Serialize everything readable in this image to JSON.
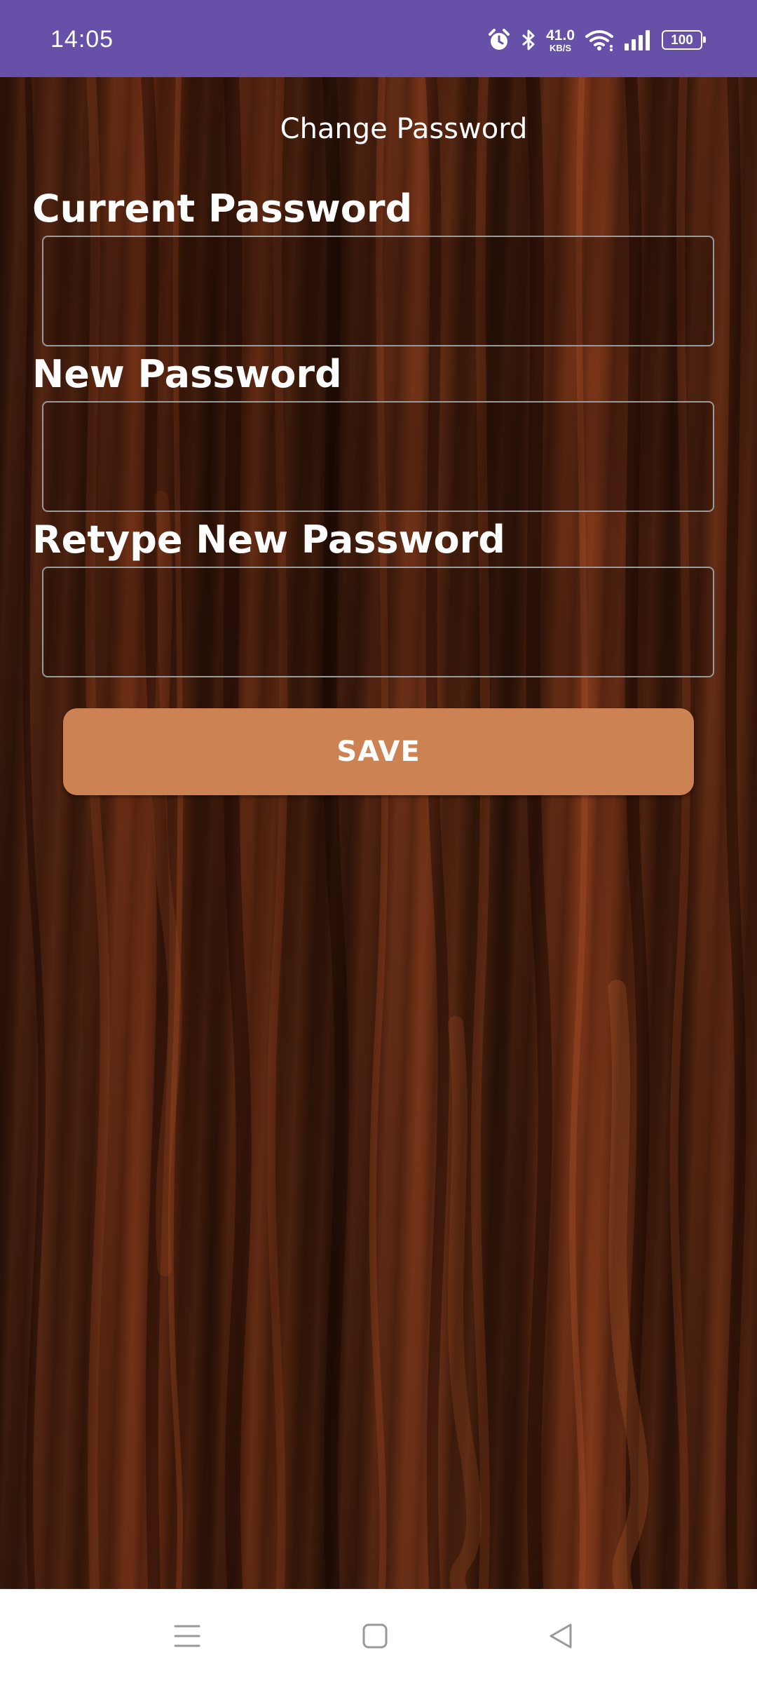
{
  "status_bar": {
    "time": "14:05",
    "network_speed_value": "41.0",
    "network_speed_unit": "KB/S",
    "battery_level": "100",
    "icons": [
      "alarm-icon",
      "bluetooth-icon",
      "wifi-icon",
      "signal-icon",
      "battery-icon"
    ]
  },
  "screen": {
    "title": "Change Password"
  },
  "form": {
    "current_password_label": "Current Password",
    "current_password_value": "",
    "new_password_label": "New Password",
    "new_password_value": "",
    "retype_password_label": "Retype New Password",
    "retype_password_value": "",
    "save_label": "SAVE"
  },
  "nav_bar": {
    "icons": [
      "menu-icon",
      "home-icon",
      "back-icon"
    ]
  },
  "colors": {
    "status_bar": "#6650a8",
    "save_button": "#cc8252",
    "input_border": "#9a9a9a",
    "text": "#ffffff"
  }
}
